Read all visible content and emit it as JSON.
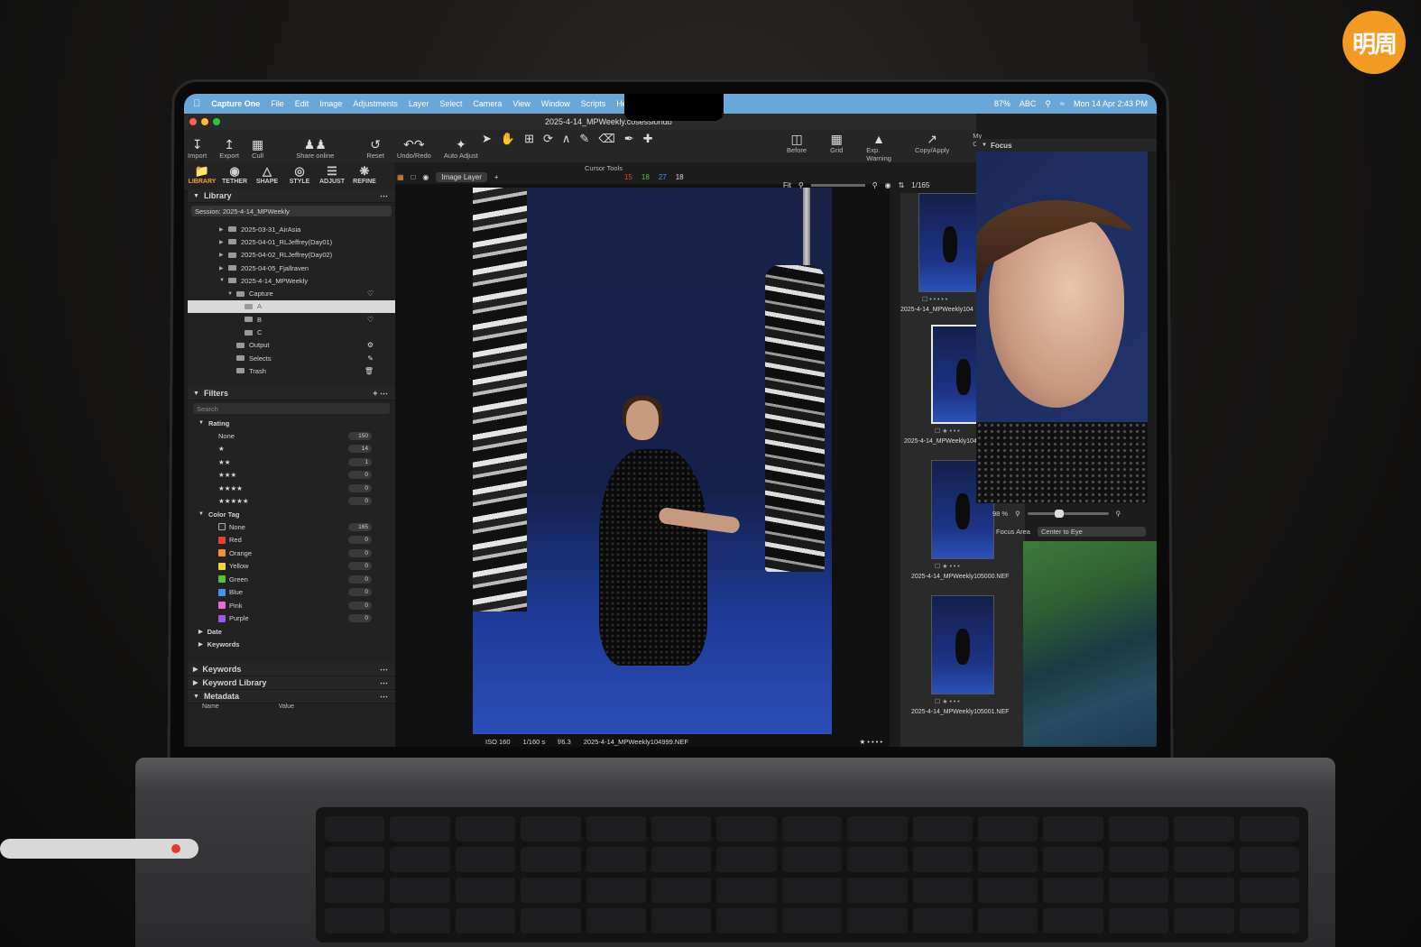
{
  "watermark": "明周",
  "menubar": {
    "app": "Capture One",
    "items": [
      "File",
      "Edit",
      "Image",
      "Adjustments",
      "Layer",
      "Select",
      "Camera",
      "View",
      "Window",
      "Scripts",
      "Help"
    ],
    "battery": "87%",
    "input": "ABC",
    "clock": "Mon 14 Apr 2:43 PM"
  },
  "window": {
    "title": "2025-4-14_MPWeekly.cosessiondb"
  },
  "toolbar": {
    "import": "Import",
    "export": "Export",
    "cull": "Cull",
    "share": "Share online",
    "reset": "Reset",
    "undo_redo": "Undo/Redo",
    "auto_adjust": "Auto Adjust",
    "cursor_tools": "Cursor Tools",
    "before": "Before",
    "grid": "Grid",
    "exp_warning": "Exp. Warning",
    "copy_apply": "Copy/Apply",
    "my_ca": "My Ca"
  },
  "tooltabs": [
    "LIBRARY",
    "TETHER",
    "SHAPE",
    "STYLE",
    "ADJUST",
    "REFINE"
  ],
  "viewer_head": {
    "layer": "Image Layer",
    "counts": [
      "15",
      "18",
      "27",
      "18"
    ]
  },
  "library": {
    "title": "Library",
    "session": "Session: 2025-4-14_MPWeekly",
    "folders": [
      {
        "label": "2025-03-31_AirAsia",
        "indent": 1
      },
      {
        "label": "2025-04-01_RLJeffrey(Day01)",
        "indent": 1
      },
      {
        "label": "2025-04-02_RLJeffrey(Day02)",
        "indent": 1
      },
      {
        "label": "2025-04-05_Fjallraven",
        "indent": 1
      },
      {
        "label": "2025-4-14_MPWeekly",
        "indent": 1
      },
      {
        "label": "Capture",
        "indent": 2
      },
      {
        "label": "A",
        "indent": 3
      },
      {
        "label": "B",
        "indent": 3
      },
      {
        "label": "C",
        "indent": 3
      },
      {
        "label": "Output",
        "indent": 2
      },
      {
        "label": "Selects",
        "indent": 2
      },
      {
        "label": "Trash",
        "indent": 2
      }
    ]
  },
  "filters": {
    "title": "Filters",
    "search_placeholder": "Search",
    "rating_title": "Rating",
    "rating": [
      {
        "label": "None",
        "count": "150"
      },
      {
        "label": "★",
        "count": "14"
      },
      {
        "label": "★★",
        "count": "1"
      },
      {
        "label": "★★★",
        "count": "0"
      },
      {
        "label": "★★★★",
        "count": "0"
      },
      {
        "label": "★★★★★",
        "count": "0"
      }
    ],
    "color_title": "Color Tag",
    "colors": [
      {
        "label": "None",
        "count": "165",
        "color": "#2a2a2a"
      },
      {
        "label": "Red",
        "count": "0",
        "color": "#e0413a"
      },
      {
        "label": "Orange",
        "count": "0",
        "color": "#f0922e"
      },
      {
        "label": "Yellow",
        "count": "0",
        "color": "#f3d43b"
      },
      {
        "label": "Green",
        "count": "0",
        "color": "#4fc24a"
      },
      {
        "label": "Blue",
        "count": "0",
        "color": "#4a8ef0"
      },
      {
        "label": "Pink",
        "count": "0",
        "color": "#e86bcf"
      },
      {
        "label": "Purple",
        "count": "0",
        "color": "#9a5ae6"
      }
    ],
    "date": "Date",
    "keywords": "Keywords"
  },
  "panels": {
    "keywords": "Keywords",
    "keyword_library": "Keyword Library",
    "metadata": "Metadata",
    "meta_name": "Name",
    "meta_value": "Value"
  },
  "viewer_status": {
    "iso": "ISO 160",
    "shutter": "1/160 s",
    "aperture": "f/6.3",
    "filename": "2025-4-14_MPWeekly104999.NEF",
    "stars": "★ • • • •"
  },
  "browser": {
    "fit": "Fit",
    "counter": "1/165",
    "thumbs": [
      {
        "label": "2025-4-14_MPWeekly104"
      },
      {
        "label": "2025-4-14_MPWeekly104"
      },
      {
        "label": "2025-4-14_MPWeekly105000.NEF"
      },
      {
        "label": "2025-4-14_MPWeekly105001.NEF"
      }
    ]
  },
  "focus": {
    "title": "Focus",
    "zoom": "98 %",
    "area_label": "Focus Area",
    "area_value": "Center to Eye"
  }
}
